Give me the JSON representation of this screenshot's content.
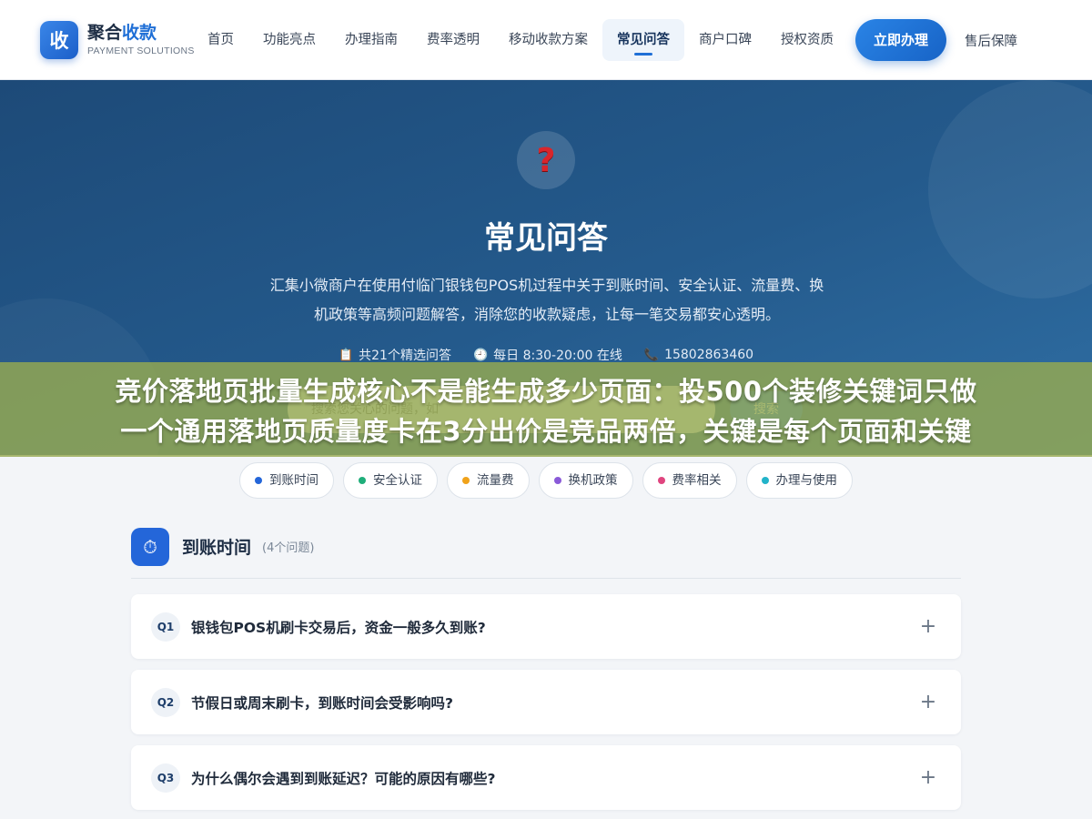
{
  "header": {
    "logo_mark": "收",
    "logo_title_main": "聚合",
    "logo_title_accent": "收款",
    "logo_sub": "PAYMENT SOLUTIONS",
    "nav": [
      {
        "label": "首页"
      },
      {
        "label": "功能亮点"
      },
      {
        "label": "办理指南"
      },
      {
        "label": "费率透明"
      },
      {
        "label": "移动收款方案"
      },
      {
        "label": "常见问答",
        "active": true
      },
      {
        "label": "商户口碑"
      },
      {
        "label": "授权资质"
      }
    ],
    "cta_label": "立即办理",
    "after_label": "售后保障"
  },
  "hero": {
    "icon": "question-mark-icon",
    "icon_glyph": "?",
    "title": "常见问答",
    "description": "汇集小微商户在使用付临门银钱包POS机过程中关于到账时间、安全认证、流量费、换机政策等高频问题解答，消除您的收款疑虑，让每一笔交易都安心透明。",
    "meta": [
      {
        "icon": "clipboard-icon",
        "glyph": "📋",
        "text": "共21个精选问答"
      },
      {
        "icon": "clock-icon",
        "glyph": "🕘",
        "text": "每日 8:30-20:00 在线"
      },
      {
        "icon": "phone-icon",
        "glyph": "📞",
        "text": "15802863460"
      }
    ],
    "search": {
      "placeholder": "搜索您关心的问题，如",
      "button_label": "搜索"
    }
  },
  "banner": {
    "line1": "竞价落地页批量生成核心不是能生成多少页面：投500个装修关键词只做",
    "line2": "一个通用落地页质量度卡在3分出价是竞品两倍，关键是每个页面和关键"
  },
  "chips": [
    {
      "label": "到账时间",
      "color": "#2466d9"
    },
    {
      "label": "安全认证",
      "color": "#1fae7a"
    },
    {
      "label": "流量费",
      "color": "#f0a21a"
    },
    {
      "label": "换机政策",
      "color": "#8a5ad8"
    },
    {
      "label": "费率相关",
      "color": "#e0457f"
    },
    {
      "label": "办理与使用",
      "color": "#22b3c9"
    }
  ],
  "section": {
    "icon": "stopwatch-icon",
    "icon_glyph": "⏱",
    "title": "到账时间",
    "count": "(4个问题)",
    "questions": [
      {
        "badge": "Q1",
        "text": "银钱包POS机刷卡交易后，资金一般多久到账?"
      },
      {
        "badge": "Q2",
        "text": "节假日或周末刷卡，到账时间会受影响吗?"
      },
      {
        "badge": "Q3",
        "text": "为什么偶尔会遇到到账延迟？可能的原因有哪些?"
      }
    ],
    "expand_glyph": "+"
  },
  "colors": {
    "brand": "#1f6fd6",
    "hero_bg": "#245a8c",
    "banner_bg": "#96aa50"
  }
}
